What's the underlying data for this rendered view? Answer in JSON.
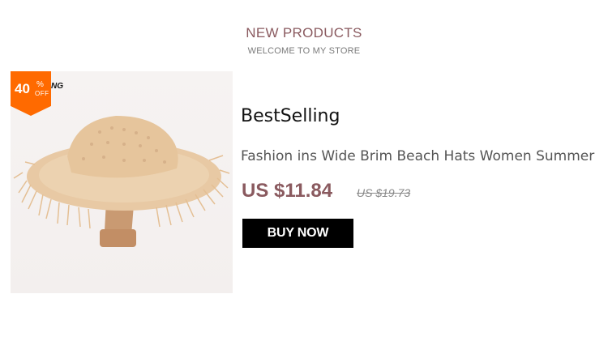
{
  "section": {
    "title": "NEW PRODUCTS",
    "subtitle": "WELCOME TO MY STORE"
  },
  "product": {
    "image_alt": "straw-wide-brim-hat",
    "discount": {
      "number": "40",
      "percent_symbol": "%",
      "off_label": "OFF",
      "tail_text": "NG"
    },
    "tag": "BestSelling",
    "name": "Fashion ins Wide Brim Beach Hats Women Summer",
    "price_current": "US $11.84",
    "price_original": "US $19.73",
    "buy_label": "BUY NOW"
  },
  "colors": {
    "accent": "#8a5a5f",
    "badge": "#ff6a00",
    "button_bg": "#000000"
  }
}
